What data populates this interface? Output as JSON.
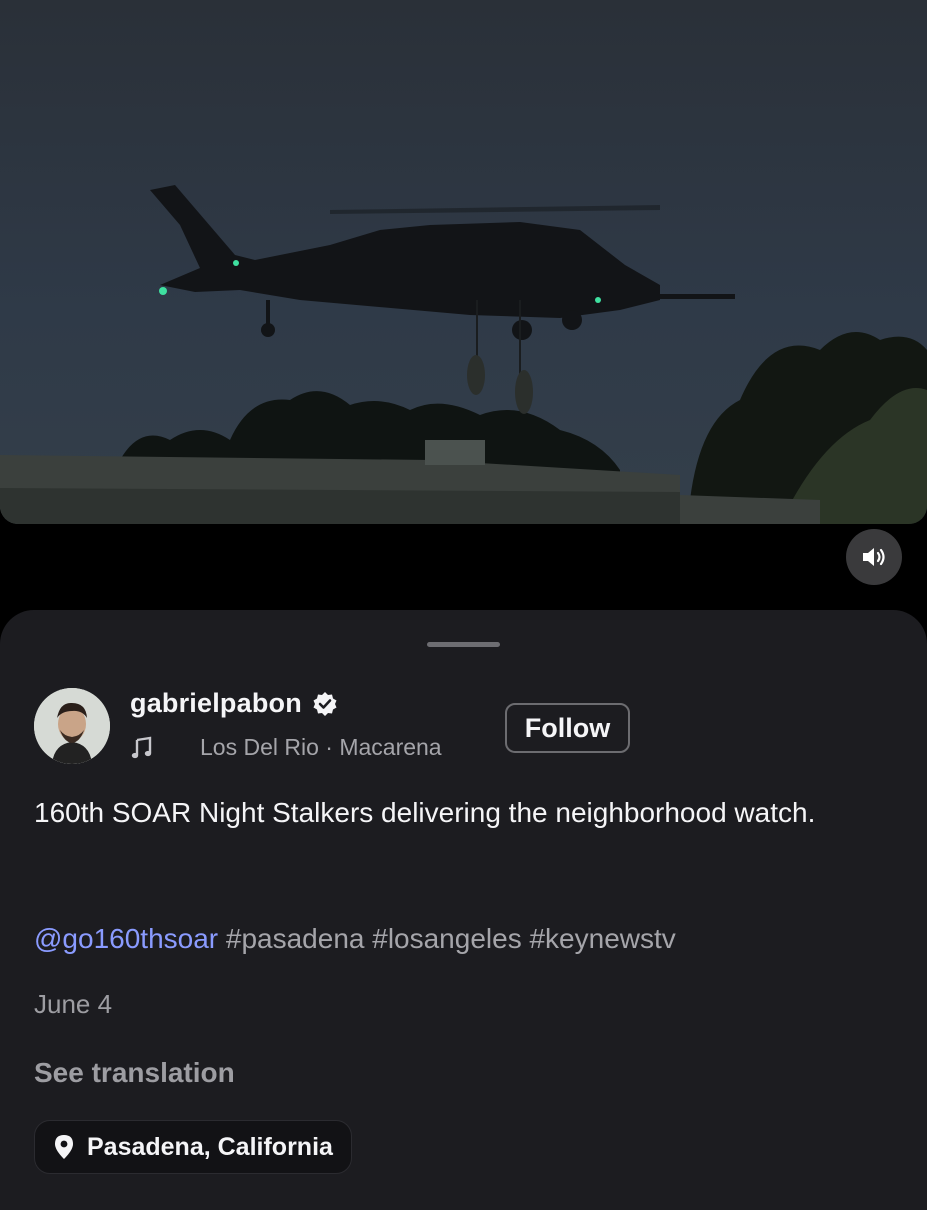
{
  "video": {
    "description_icon": "night-helicopter-scene"
  },
  "controls": {
    "mute_icon": "speaker-icon"
  },
  "post": {
    "username": "gabrielpabon",
    "verified": true,
    "music": "Los Del Rio · Macarena",
    "follow_label": "Follow",
    "caption": "160th SOAR Night Stalkers delivering the neighborhood watch.",
    "mention": "@go160thsoar",
    "hashtags": "#pasadena #losangeles #keynewstv",
    "date": "June 4",
    "see_translation": "See translation",
    "location": "Pasadena, California"
  },
  "colors": {
    "sheet_bg": "#1c1c20",
    "mention": "#8a9bff",
    "muted_text": "#9d9da2"
  }
}
